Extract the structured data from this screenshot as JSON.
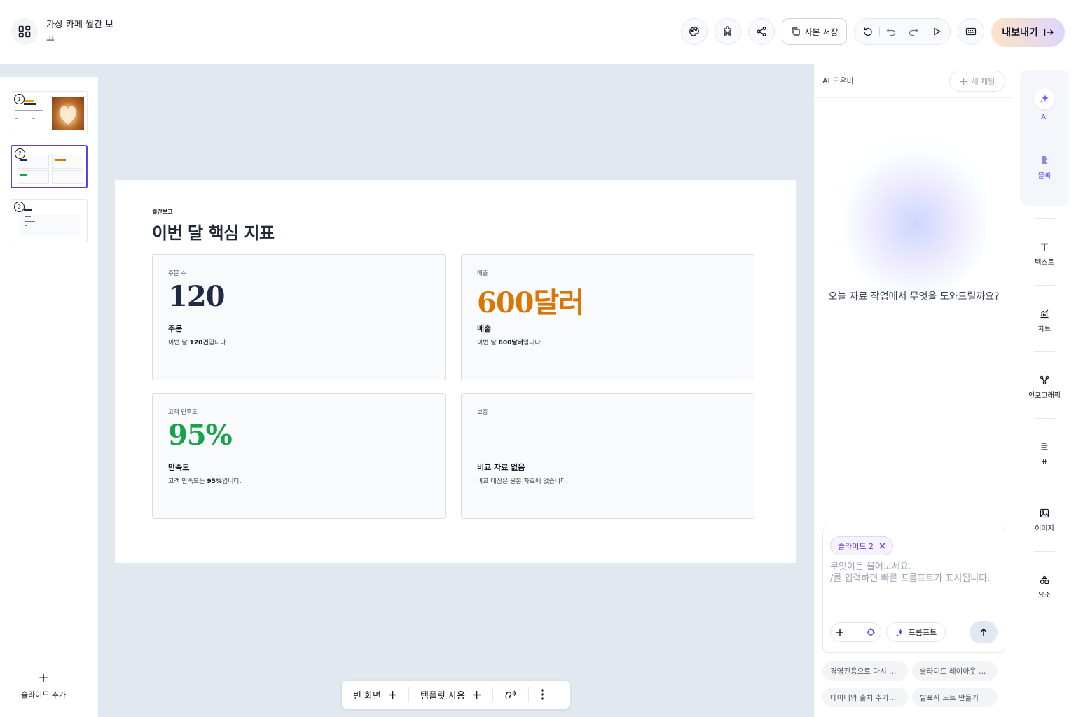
{
  "header": {
    "title": "가상 카페 월간 보고",
    "save_copy": "사본 저장",
    "export": "내보내기"
  },
  "thumbnails": {
    "nums": [
      "1",
      "2",
      "3"
    ]
  },
  "left_panel": {
    "add_slide": "슬라이드 추가"
  },
  "slide": {
    "kicker": "월간보고",
    "title": "이번 달 핵심 지표",
    "cards": [
      {
        "label": "주문 수",
        "value": "120",
        "heading": "주문",
        "desc_prefix": "이번 달 ",
        "desc_bold": "120건",
        "desc_suffix": "입니다.",
        "color": "#1f2a44"
      },
      {
        "label": "매출",
        "value": "600달러",
        "heading": "매출",
        "desc_prefix": "이번 달 ",
        "desc_bold": "600달러",
        "desc_suffix": "입니다.",
        "color": "#d97706"
      },
      {
        "label": "고객 만족도",
        "value": "95%",
        "heading": "만족도",
        "desc_prefix": "고객 만족도는 ",
        "desc_bold": "95%",
        "desc_suffix": "입니다.",
        "color": "#16a34a"
      },
      {
        "label": "보충",
        "value": "",
        "heading": "비교 자료 없음",
        "desc_prefix": "비교 대상은 원본 자료에 없습니다.",
        "desc_bold": "",
        "desc_suffix": "",
        "color": "#1f2a44"
      }
    ]
  },
  "bottom_bar": {
    "blank": "빈 화면",
    "template": "템플릿 사용"
  },
  "ai_panel": {
    "title": "AI 도우미",
    "new_chat": "새 채팅",
    "greeting": "오늘 자료 작업에서 무엇을 도와드릴까요?",
    "context_chip": "슬라이드 2",
    "placeholder": "무엇이든 물어보세요.\n/를 입력하면 빠른 프롬프트가 표시됩니다.",
    "prompt_button": "프롬프트",
    "suggestions": [
      "경영진용으로 다시 …",
      "슬라이드 레이아웃 …",
      "데이터와 출처 추가…",
      "발표자 노트 만들기"
    ]
  },
  "right_rail": {
    "items": [
      "AI",
      "블록",
      "텍스트",
      "차트",
      "인포그래픽",
      "표",
      "이미지",
      "요소"
    ]
  },
  "colors": {
    "accent": "#4f46e5",
    "orders": "#1f2a44",
    "revenue": "#d97706",
    "satisfaction": "#16a34a"
  }
}
